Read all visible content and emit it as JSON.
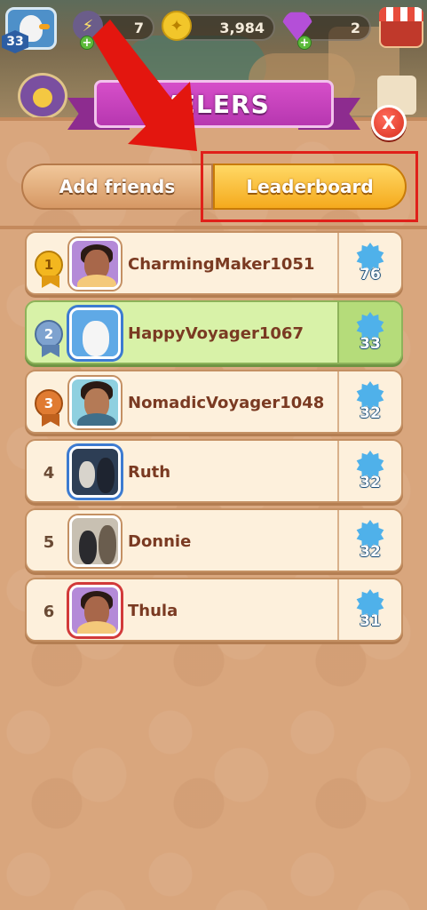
{
  "hud": {
    "level": "33",
    "energy": "7",
    "coins": "3,984",
    "gems": "2",
    "plus_symbol": "+"
  },
  "panel": {
    "title": "VELERS",
    "close_label": "X"
  },
  "tabs": {
    "add_friends": "Add friends",
    "leaderboard": "Leaderboard",
    "active": "leaderboard"
  },
  "leaderboard": [
    {
      "rank": "1",
      "name": "CharmingMaker1051",
      "score": "76",
      "medal": "gold",
      "current_user": false
    },
    {
      "rank": "2",
      "name": "HappyVoyager1067",
      "score": "33",
      "medal": "silver",
      "current_user": true
    },
    {
      "rank": "3",
      "name": "NomadicVoyager1048",
      "score": "32",
      "medal": "bronze",
      "current_user": false
    },
    {
      "rank": "4",
      "name": "Ruth",
      "score": "32",
      "medal": "",
      "current_user": false
    },
    {
      "rank": "5",
      "name": "Donnie",
      "score": "32",
      "medal": "",
      "current_user": false
    },
    {
      "rank": "6",
      "name": "Thula",
      "score": "31",
      "medal": "",
      "current_user": false
    }
  ],
  "colors": {
    "panel_bg": "#d9a67d",
    "highlight": "#e0201a",
    "active_tab": "#f5aa1d",
    "current_user_row": "#d8f2a8",
    "score_star": "#4fb1ea"
  }
}
